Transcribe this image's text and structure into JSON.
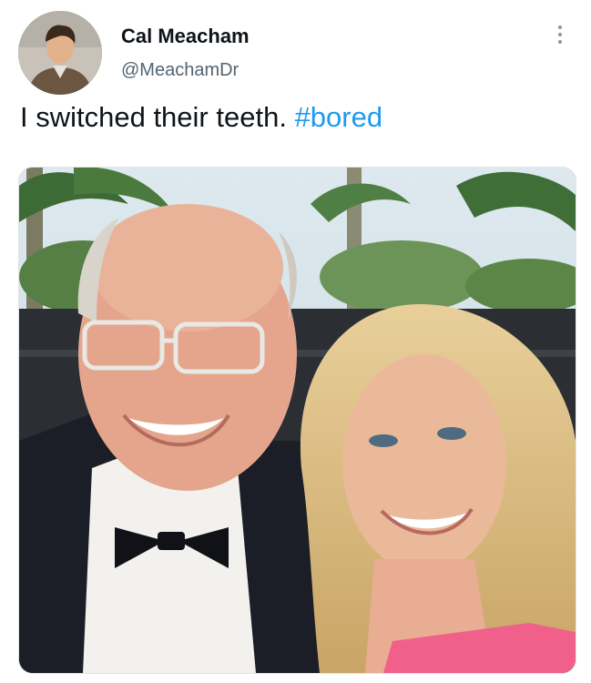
{
  "tweet": {
    "author": {
      "display_name": "Cal Meacham",
      "handle": "@MeachamDr",
      "avatar_icon": "profile-photo"
    },
    "text": "I switched their teeth.",
    "hashtag": "#bored",
    "more_icon": "more-options-icon",
    "media": {
      "type": "photo",
      "description_icon": "photo"
    }
  },
  "colors": {
    "text": "#0f1419",
    "secondary": "#536471",
    "link": "#1d9bf0"
  }
}
